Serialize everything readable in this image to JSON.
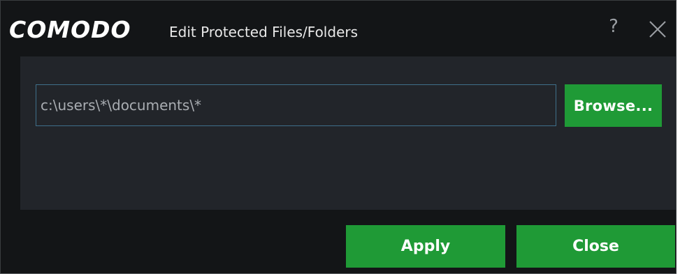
{
  "window": {
    "brand": "COMODO",
    "title": "Edit Protected Files/Folders",
    "help_label": "?",
    "close_icon": "close-icon"
  },
  "form": {
    "path_value": "c:\\users\\*\\documents\\*",
    "browse_label": "Browse..."
  },
  "footer": {
    "apply_label": "Apply",
    "close_label": "Close"
  },
  "colors": {
    "background": "#131517",
    "panel": "#22252a",
    "accent_green": "#1f9a36",
    "input_border": "#3f6f8a"
  }
}
